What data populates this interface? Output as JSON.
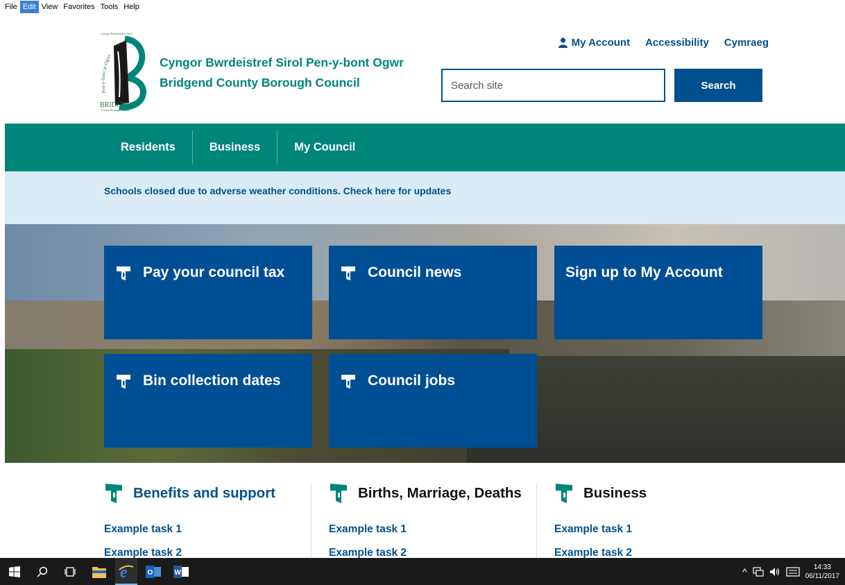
{
  "menubar": {
    "items": [
      "File",
      "Edit",
      "View",
      "Favorites",
      "Tools",
      "Help"
    ]
  },
  "header": {
    "name_welsh": "Cyngor Bwrdeistref Sirol Pen-y-bont Ogwr",
    "name_english": "Bridgend County Borough Council",
    "logo": {
      "top_text": "Cyngor Bwrdeistref Sirol",
      "arc_text": "Pen-y-bont ar Ogwr",
      "bottom_text": "BRIDGEND",
      "sub_text": "County Borough Council"
    },
    "links": {
      "account": "My Account",
      "accessibility": "Accessibility",
      "language": "Cymraeg"
    },
    "search": {
      "placeholder": "Search site",
      "button": "Search"
    }
  },
  "nav": {
    "items": [
      "Residents",
      "Business",
      "My Council"
    ]
  },
  "alert": {
    "text": "Schools closed due to adverse weather conditions. Check here for updates"
  },
  "tiles": [
    {
      "label": "Pay your council tax",
      "icon": "signpost-icon"
    },
    {
      "label": "Council news",
      "icon": "signpost-icon"
    },
    {
      "label": "Sign up to My Account"
    },
    {
      "label": "Bin collection dates",
      "icon": "signpost-icon"
    },
    {
      "label": "Council jobs",
      "icon": "signpost-icon"
    }
  ],
  "categories": [
    {
      "title": "Benefits and support",
      "title_color": "#00508f",
      "tasks": [
        "Example task 1",
        "Example task 2"
      ]
    },
    {
      "title": "Births, Marriage, Deaths",
      "title_color": "#111111",
      "tasks": [
        "Example task 1",
        "Example task 2"
      ]
    },
    {
      "title": "Business",
      "title_color": "#111111",
      "tasks": [
        "Example task 1",
        "Example task 2"
      ]
    }
  ],
  "taskbar": {
    "icons": [
      "windows-start-icon",
      "search-icon",
      "task-view-icon",
      "file-explorer-icon",
      "internet-explorer-icon",
      "outlook-icon",
      "word-icon"
    ],
    "clock": {
      "time": "14:33",
      "date": "06/11/2017"
    }
  },
  "colors": {
    "brand_teal": "#00857a",
    "brand_blue": "#00508f",
    "tile_blue": "#004e93",
    "alert_bg": "#d9ebf4"
  }
}
